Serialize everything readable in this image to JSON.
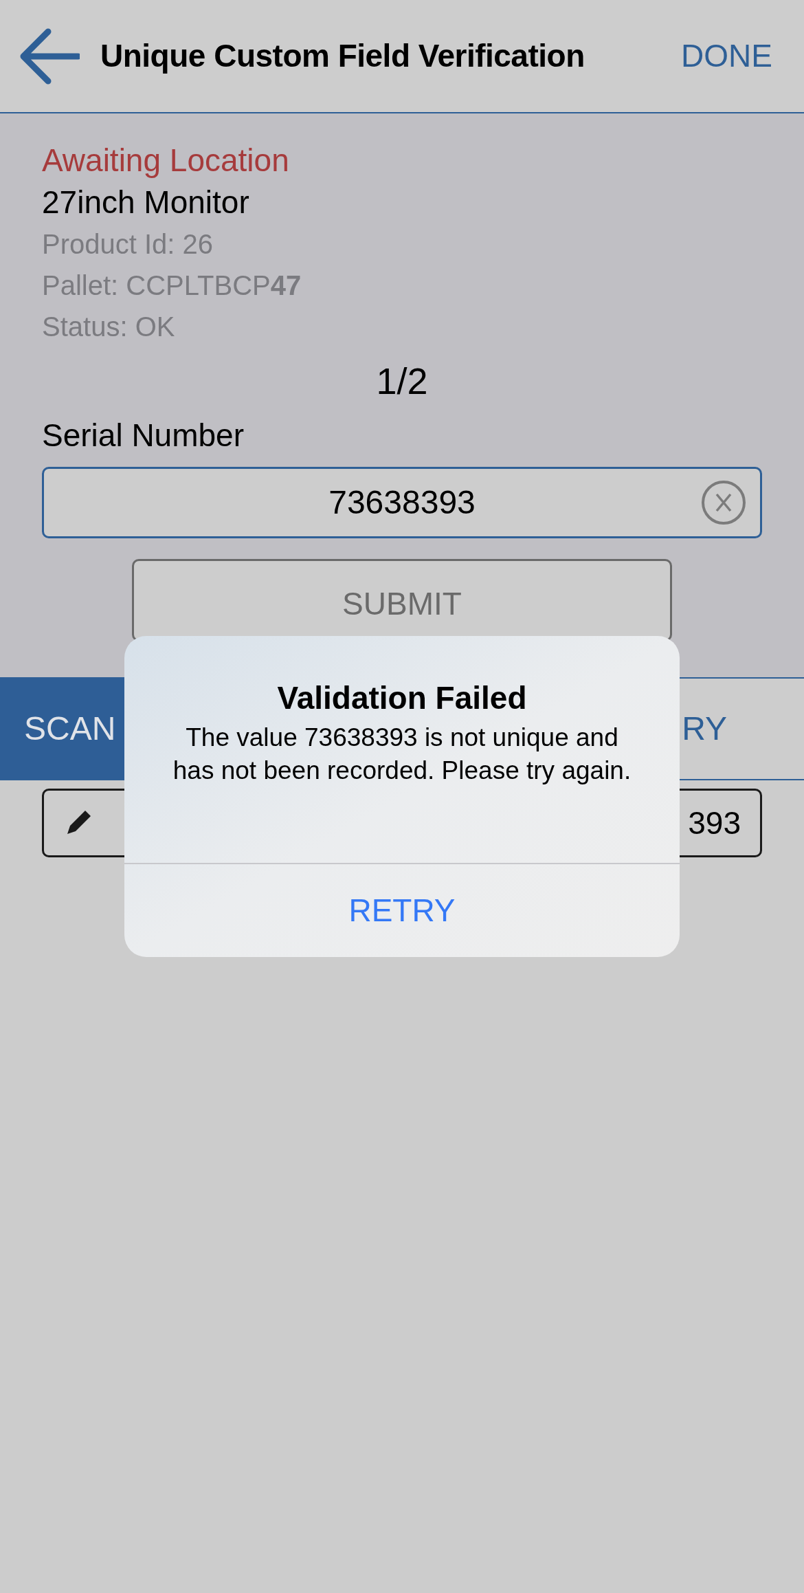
{
  "header": {
    "title": "Unique Custom Field Verification",
    "done": "DONE"
  },
  "item": {
    "status": "Awaiting Location",
    "name": "27inch Monitor",
    "details": [
      "Product Id: 26",
      "Pallet: CCPLTBCP**47**",
      "Status: OK"
    ]
  },
  "counter": "1/2",
  "field": {
    "label": "Serial Number",
    "value": "73638393"
  },
  "submit": "SUBMIT",
  "tabs": [
    {
      "label": "SCAN",
      "selected": true
    },
    {
      "label": "RY",
      "selected": false
    }
  ],
  "entry": {
    "text_end": "393"
  },
  "dialog": {
    "title": "Validation Failed",
    "message": "The value 73638393 is not unique and has not been recorded. Please try again.",
    "button": "RETRY"
  }
}
